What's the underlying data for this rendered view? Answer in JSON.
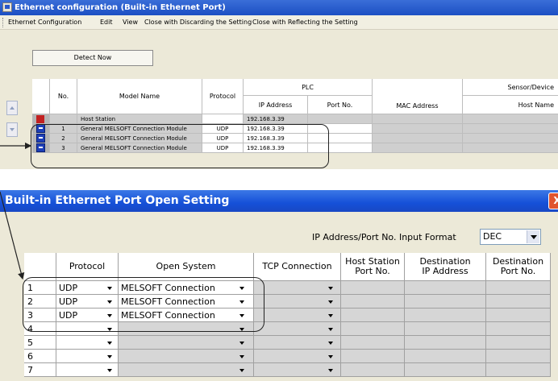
{
  "top_window": {
    "title": "Ethernet configuration (Built-in Ethernet Port)",
    "menu": [
      "Ethernet Configuration",
      "Edit",
      "View",
      "Close with Discarding the Setting",
      "Close with Reflecting the Setting"
    ],
    "detect_label": "Detect Now",
    "headers": {
      "no": "No.",
      "model": "Model Name",
      "protocol": "Protocol",
      "plc": "PLC",
      "ip": "IP Address",
      "port": "Port No.",
      "mac": "MAC Address",
      "sensor": "Sensor/Device",
      "hostname": "Host Name"
    },
    "rows": [
      {
        "no": "",
        "model": "Host Station",
        "protocol": "",
        "ip": "192.168.3.39"
      },
      {
        "no": "1",
        "model": "General MELSOFT Connection Module",
        "protocol": "UDP",
        "ip": "192.168.3.39"
      },
      {
        "no": "2",
        "model": "General MELSOFT Connection Module",
        "protocol": "UDP",
        "ip": "192.168.3.39"
      },
      {
        "no": "3",
        "model": "General MELSOFT Connection Module",
        "protocol": "UDP",
        "ip": "192.168.3.39"
      }
    ]
  },
  "dialog": {
    "title": "Built-in Ethernet Port Open Setting",
    "close_label": "X",
    "format_label": "IP Address/Port No. Input Format",
    "format_value": "DEC",
    "headers": {
      "protocol": "Protocol",
      "open_system": "Open System",
      "tcp": "TCP Connection",
      "host_port_1": "Host Station",
      "host_port_2": "Port No.",
      "dest_ip_1": "Destination",
      "dest_ip_2": "IP Address",
      "dest_port_1": "Destination",
      "dest_port_2": "Port No."
    },
    "rows": [
      {
        "no": "1",
        "protocol": "UDP",
        "open_system": "MELSOFT Connection"
      },
      {
        "no": "2",
        "protocol": "UDP",
        "open_system": "MELSOFT Connection"
      },
      {
        "no": "3",
        "protocol": "UDP",
        "open_system": "MELSOFT Connection"
      },
      {
        "no": "4",
        "protocol": "",
        "open_system": ""
      },
      {
        "no": "5",
        "protocol": "",
        "open_system": ""
      },
      {
        "no": "6",
        "protocol": "",
        "open_system": ""
      },
      {
        "no": "7",
        "protocol": "",
        "open_system": ""
      }
    ]
  }
}
